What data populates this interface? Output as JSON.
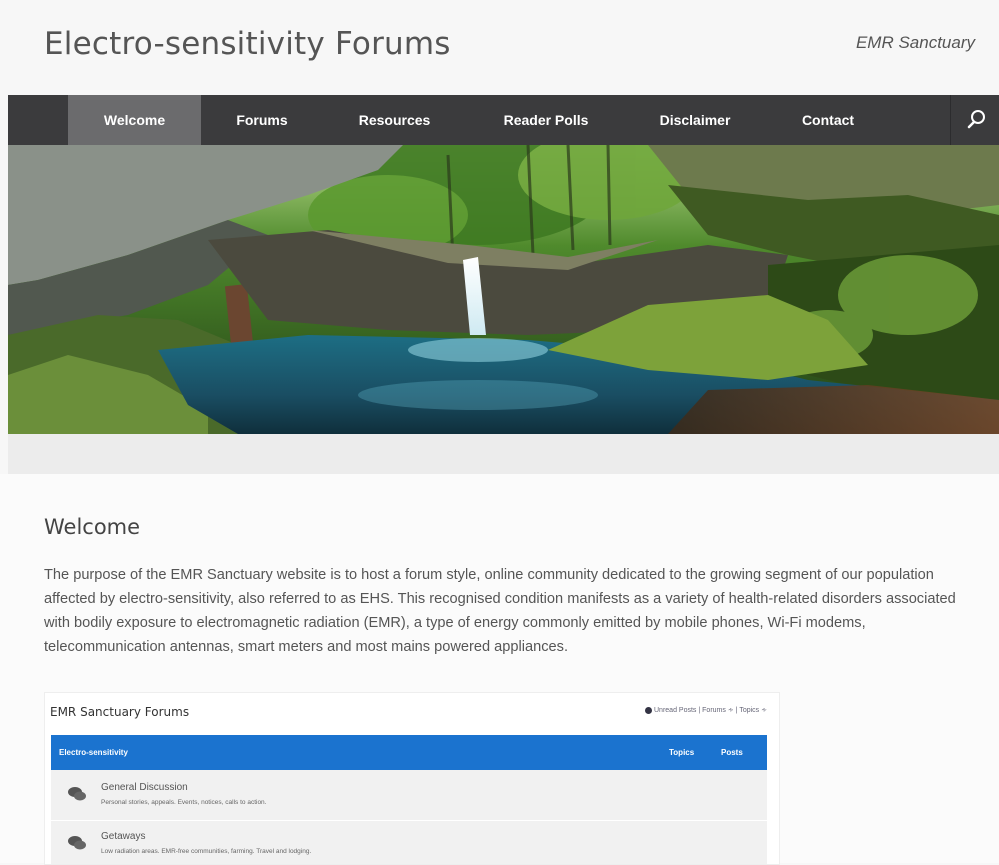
{
  "header": {
    "site_title": "Electro-sensitivity Forums",
    "tagline": "EMR Sanctuary"
  },
  "nav": {
    "items": [
      "Welcome",
      "Forums",
      "Resources",
      "Reader Polls",
      "Disclaimer",
      "Contact"
    ],
    "active": "Welcome",
    "search_icon": "search-icon"
  },
  "main": {
    "heading": "Welcome",
    "intro": "The purpose of the EMR Sanctuary website is to host a forum style, online community dedicated to the growing segment of our population affected by electro-sensitivity, also referred to as EHS. This recognised condition manifests as a variety of health-related disorders associated with bodily exposure to electromagnetic radiation (EMR), a type of energy commonly emitted by mobile phones, Wi-Fi modems, telecommunication antennas, smart meters and most mains powered appliances."
  },
  "forum_preview": {
    "title": "EMR Sanctuary Forums",
    "links": {
      "unread": "Unread Posts",
      "forums": "Forums",
      "topics": "Topics",
      "sep": "|"
    },
    "category": "Electro-sensitivity",
    "col_topics": "Topics",
    "col_posts": "Posts",
    "rows": [
      {
        "title": "General Discussion",
        "desc": "Personal stories, appeals. Events, notices, calls to action."
      },
      {
        "title": "Getaways",
        "desc": "Low radiation areas. EMR-free communities, farming. Travel and lodging."
      }
    ]
  },
  "colors": {
    "nav_bg": "#3b3b3d",
    "nav_active": "#6b6b6d",
    "forum_bar": "#1b73cf"
  }
}
